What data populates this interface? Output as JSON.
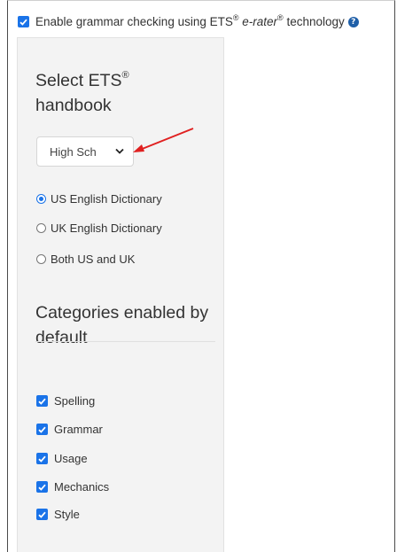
{
  "grammar_checking": {
    "checked": true,
    "label_prefix": "Enable grammar checking using ETS",
    "reg": "®",
    "product": "e-rater",
    "label_suffix": "technology",
    "help_icon": "question-circle-icon"
  },
  "handbook": {
    "title": "Select ETS",
    "title_reg": "®",
    "title_line2": "handbook",
    "select_value": "High Sch"
  },
  "dictionary": {
    "options": [
      {
        "label": "US English Dictionary",
        "selected": true
      },
      {
        "label": "UK English Dictionary",
        "selected": false
      },
      {
        "label": "Both US and UK",
        "selected": false
      }
    ]
  },
  "categories": {
    "title": "Categories enabled by default",
    "items": [
      {
        "label": "Spelling",
        "checked": true
      },
      {
        "label": "Grammar",
        "checked": true
      },
      {
        "label": "Usage",
        "checked": true
      },
      {
        "label": "Mechanics",
        "checked": true
      },
      {
        "label": "Style",
        "checked": true
      }
    ]
  },
  "colors": {
    "checkbox": "#1a73e8",
    "panel_bg": "#f3f3f3",
    "annotation_arrow": "#e02020"
  }
}
